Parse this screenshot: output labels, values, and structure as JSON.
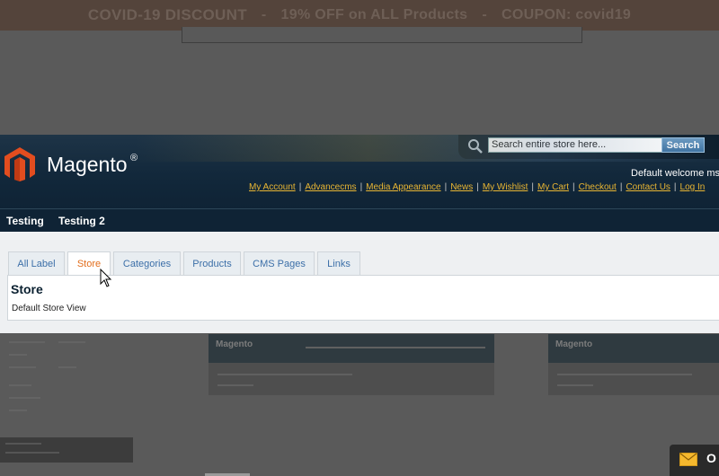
{
  "banner": {
    "headline": "COVID-19 DISCOUNT",
    "sep1": "-",
    "offer": "19% OFF on ALL Products",
    "sep2": "-",
    "coupon": "COUPON: covid19"
  },
  "store": {
    "logo_text": "Magento",
    "logo_reg": "®",
    "search": {
      "placeholder": "Search entire store here...",
      "button_label": "Search"
    },
    "welcome": "Default welcome msg",
    "top_links": [
      "My Account",
      "Advancecms",
      "Media Appearance",
      "News",
      "My Wishlist",
      "My Cart",
      "Checkout",
      "Contact Us",
      "Log In"
    ],
    "nav": [
      "Testing",
      "Testing 2"
    ],
    "tabs": [
      "All Label",
      "Store",
      "Categories",
      "Products",
      "CMS Pages",
      "Links"
    ],
    "active_tab": "Store",
    "panel": {
      "title": "Store",
      "text": "Default Store View"
    }
  },
  "background_thumb": {
    "logo_text": "Magento"
  },
  "chat": {
    "label": "O"
  },
  "colors": {
    "header": "#12283b",
    "link": "#e8b533",
    "active_tab": "#e26d1c",
    "tab_text": "#3c6fa8",
    "banner": "#54443b"
  }
}
